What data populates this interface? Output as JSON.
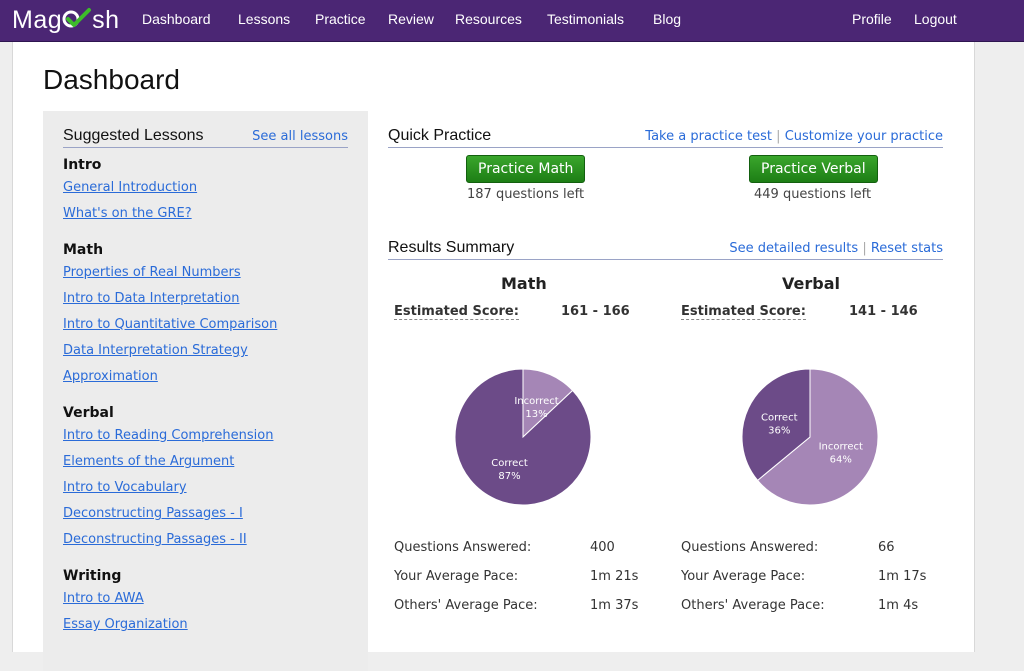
{
  "brand": {
    "logo_text": "Magoosh"
  },
  "nav": {
    "items": [
      "Dashboard",
      "Lessons",
      "Practice",
      "Review",
      "Resources",
      "Testimonials",
      "Blog"
    ],
    "profile": "Profile",
    "logout": "Logout"
  },
  "page": {
    "title": "Dashboard"
  },
  "sidebar": {
    "title": "Suggested Lessons",
    "see_all": "See all lessons",
    "categories": [
      {
        "name": "Intro",
        "links": [
          "General Introduction",
          "What's on the GRE?"
        ]
      },
      {
        "name": "Math",
        "links": [
          "Properties of Real Numbers",
          "Intro to Data Interpretation",
          "Intro to Quantitative Comparison",
          "Data Interpretation Strategy",
          "Approximation"
        ]
      },
      {
        "name": "Verbal",
        "links": [
          "Intro to Reading Comprehension",
          "Elements of the Argument",
          "Intro to Vocabulary",
          "Deconstructing Passages - I",
          "Deconstructing Passages - II"
        ]
      },
      {
        "name": "Writing",
        "links": [
          "Intro to AWA",
          "Essay Organization"
        ]
      }
    ]
  },
  "quick_practice": {
    "title": "Quick Practice",
    "link_take_test": "Take a practice test",
    "separator": "|",
    "link_customize": "Customize your practice",
    "math_button": "Practice Math",
    "math_left": "187 questions left",
    "verbal_button": "Practice Verbal",
    "verbal_left": "449 questions left"
  },
  "results": {
    "title": "Results Summary",
    "link_detailed": "See detailed results",
    "separator": "|",
    "link_reset": "Reset stats",
    "est_label": "Estimated Score:",
    "labels": {
      "answered": "Questions Answered:",
      "pace": "Your Average Pace:",
      "others": "Others' Average Pace:"
    },
    "math": {
      "title": "Math",
      "score": "161 - 166",
      "answered": "400",
      "pace": "1m 21s",
      "others": "1m 37s"
    },
    "verbal": {
      "title": "Verbal",
      "score": "141 - 146",
      "answered": "66",
      "pace": "1m 17s",
      "others": "1m 4s"
    }
  },
  "chart_data": [
    {
      "type": "pie",
      "title": "Math",
      "categories": [
        "Correct",
        "Incorrect"
      ],
      "values": [
        87,
        13
      ],
      "labels": [
        "87%",
        "13%"
      ],
      "colors": [
        "#6c4b88",
        "#a586b6"
      ]
    },
    {
      "type": "pie",
      "title": "Verbal",
      "categories": [
        "Correct",
        "Incorrect"
      ],
      "values": [
        36,
        64
      ],
      "labels": [
        "36%",
        "64%"
      ],
      "colors": [
        "#6c4b88",
        "#a586b6"
      ]
    }
  ]
}
